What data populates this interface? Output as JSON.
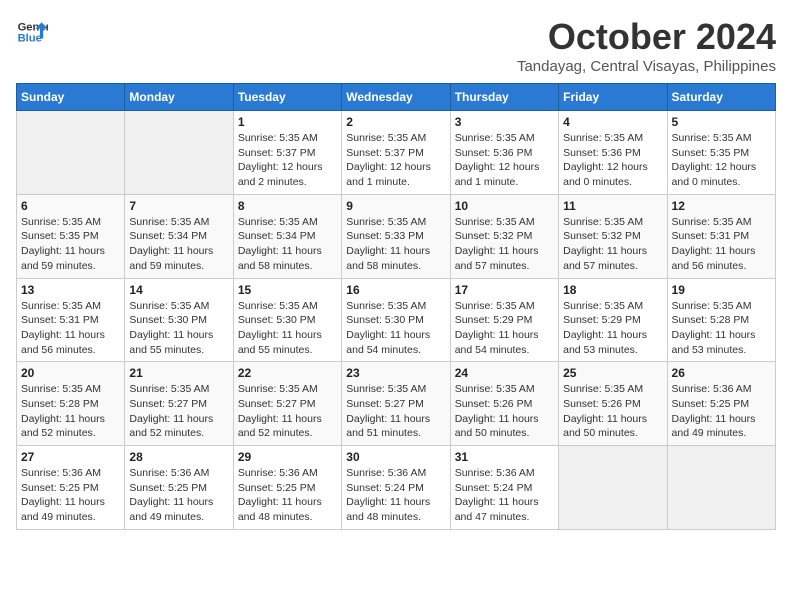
{
  "logo": {
    "line1": "General",
    "line2": "Blue"
  },
  "title": "October 2024",
  "subtitle": "Tandayag, Central Visayas, Philippines",
  "days_of_week": [
    "Sunday",
    "Monday",
    "Tuesday",
    "Wednesday",
    "Thursday",
    "Friday",
    "Saturday"
  ],
  "weeks": [
    [
      {
        "num": "",
        "info": ""
      },
      {
        "num": "",
        "info": ""
      },
      {
        "num": "1",
        "info": "Sunrise: 5:35 AM\nSunset: 5:37 PM\nDaylight: 12 hours\nand 2 minutes."
      },
      {
        "num": "2",
        "info": "Sunrise: 5:35 AM\nSunset: 5:37 PM\nDaylight: 12 hours\nand 1 minute."
      },
      {
        "num": "3",
        "info": "Sunrise: 5:35 AM\nSunset: 5:36 PM\nDaylight: 12 hours\nand 1 minute."
      },
      {
        "num": "4",
        "info": "Sunrise: 5:35 AM\nSunset: 5:36 PM\nDaylight: 12 hours\nand 0 minutes."
      },
      {
        "num": "5",
        "info": "Sunrise: 5:35 AM\nSunset: 5:35 PM\nDaylight: 12 hours\nand 0 minutes."
      }
    ],
    [
      {
        "num": "6",
        "info": "Sunrise: 5:35 AM\nSunset: 5:35 PM\nDaylight: 11 hours\nand 59 minutes."
      },
      {
        "num": "7",
        "info": "Sunrise: 5:35 AM\nSunset: 5:34 PM\nDaylight: 11 hours\nand 59 minutes."
      },
      {
        "num": "8",
        "info": "Sunrise: 5:35 AM\nSunset: 5:34 PM\nDaylight: 11 hours\nand 58 minutes."
      },
      {
        "num": "9",
        "info": "Sunrise: 5:35 AM\nSunset: 5:33 PM\nDaylight: 11 hours\nand 58 minutes."
      },
      {
        "num": "10",
        "info": "Sunrise: 5:35 AM\nSunset: 5:32 PM\nDaylight: 11 hours\nand 57 minutes."
      },
      {
        "num": "11",
        "info": "Sunrise: 5:35 AM\nSunset: 5:32 PM\nDaylight: 11 hours\nand 57 minutes."
      },
      {
        "num": "12",
        "info": "Sunrise: 5:35 AM\nSunset: 5:31 PM\nDaylight: 11 hours\nand 56 minutes."
      }
    ],
    [
      {
        "num": "13",
        "info": "Sunrise: 5:35 AM\nSunset: 5:31 PM\nDaylight: 11 hours\nand 56 minutes."
      },
      {
        "num": "14",
        "info": "Sunrise: 5:35 AM\nSunset: 5:30 PM\nDaylight: 11 hours\nand 55 minutes."
      },
      {
        "num": "15",
        "info": "Sunrise: 5:35 AM\nSunset: 5:30 PM\nDaylight: 11 hours\nand 55 minutes."
      },
      {
        "num": "16",
        "info": "Sunrise: 5:35 AM\nSunset: 5:30 PM\nDaylight: 11 hours\nand 54 minutes."
      },
      {
        "num": "17",
        "info": "Sunrise: 5:35 AM\nSunset: 5:29 PM\nDaylight: 11 hours\nand 54 minutes."
      },
      {
        "num": "18",
        "info": "Sunrise: 5:35 AM\nSunset: 5:29 PM\nDaylight: 11 hours\nand 53 minutes."
      },
      {
        "num": "19",
        "info": "Sunrise: 5:35 AM\nSunset: 5:28 PM\nDaylight: 11 hours\nand 53 minutes."
      }
    ],
    [
      {
        "num": "20",
        "info": "Sunrise: 5:35 AM\nSunset: 5:28 PM\nDaylight: 11 hours\nand 52 minutes."
      },
      {
        "num": "21",
        "info": "Sunrise: 5:35 AM\nSunset: 5:27 PM\nDaylight: 11 hours\nand 52 minutes."
      },
      {
        "num": "22",
        "info": "Sunrise: 5:35 AM\nSunset: 5:27 PM\nDaylight: 11 hours\nand 52 minutes."
      },
      {
        "num": "23",
        "info": "Sunrise: 5:35 AM\nSunset: 5:27 PM\nDaylight: 11 hours\nand 51 minutes."
      },
      {
        "num": "24",
        "info": "Sunrise: 5:35 AM\nSunset: 5:26 PM\nDaylight: 11 hours\nand 50 minutes."
      },
      {
        "num": "25",
        "info": "Sunrise: 5:35 AM\nSunset: 5:26 PM\nDaylight: 11 hours\nand 50 minutes."
      },
      {
        "num": "26",
        "info": "Sunrise: 5:36 AM\nSunset: 5:25 PM\nDaylight: 11 hours\nand 49 minutes."
      }
    ],
    [
      {
        "num": "27",
        "info": "Sunrise: 5:36 AM\nSunset: 5:25 PM\nDaylight: 11 hours\nand 49 minutes."
      },
      {
        "num": "28",
        "info": "Sunrise: 5:36 AM\nSunset: 5:25 PM\nDaylight: 11 hours\nand 49 minutes."
      },
      {
        "num": "29",
        "info": "Sunrise: 5:36 AM\nSunset: 5:25 PM\nDaylight: 11 hours\nand 48 minutes."
      },
      {
        "num": "30",
        "info": "Sunrise: 5:36 AM\nSunset: 5:24 PM\nDaylight: 11 hours\nand 48 minutes."
      },
      {
        "num": "31",
        "info": "Sunrise: 5:36 AM\nSunset: 5:24 PM\nDaylight: 11 hours\nand 47 minutes."
      },
      {
        "num": "",
        "info": ""
      },
      {
        "num": "",
        "info": ""
      }
    ]
  ]
}
